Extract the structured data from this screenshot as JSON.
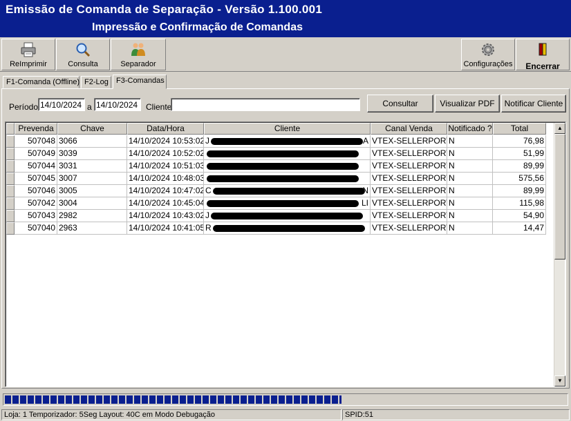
{
  "window": {
    "title": "Emissão de Comanda de Separação - Versão 1.100.001",
    "subtitle": "Impressão e Confirmação de Comandas"
  },
  "toolbar": {
    "reimprimir": {
      "label": "ReImprimir",
      "icon": "printer-icon"
    },
    "consulta": {
      "label": "Consulta",
      "icon": "magnifier-icon"
    },
    "separador": {
      "label": "Separador",
      "icon": "people-icon"
    },
    "configuracoes": {
      "label": "Configurações",
      "icon": "gear-icon"
    },
    "encerrar": {
      "label": "Encerrar",
      "icon": "exit-door-icon"
    }
  },
  "tabs": [
    {
      "label": "F1-Comanda (Offline)"
    },
    {
      "label": "F2-Log"
    },
    {
      "label": "F3-Comandas"
    }
  ],
  "filter": {
    "periodo_label": "Período",
    "date_from": "14/10/2024",
    "a_label": "a",
    "date_to": "14/10/2024",
    "cliente_label": "Cliente",
    "cliente_value": "",
    "consultar": "Consultar",
    "visualizar_pdf": "Visualizar PDF",
    "notificar_cliente": "Notificar Cliente"
  },
  "grid": {
    "columns": [
      "Prevenda",
      "Chave",
      "Data/Hora",
      "Cliente",
      "Canal Venda",
      "Notificado ?",
      "Total"
    ],
    "rows": [
      {
        "prevenda": "507048",
        "chave": "3066",
        "datahora": "14/10/2024 10:53:02",
        "cliente_prefix": "J",
        "cliente_suffix": "A",
        "canal": "VTEX-SELLERPORTA",
        "notificado": "N",
        "total": "76,98"
      },
      {
        "prevenda": "507049",
        "chave": "3039",
        "datahora": "14/10/2024 10:52:02",
        "cliente_prefix": "",
        "cliente_suffix": "",
        "canal": "VTEX-SELLERPORTA",
        "notificado": "N",
        "total": "51,99"
      },
      {
        "prevenda": "507044",
        "chave": "3031",
        "datahora": "14/10/2024 10:51:03",
        "cliente_prefix": "",
        "cliente_suffix": "",
        "canal": "VTEX-SELLERPORTA",
        "notificado": "N",
        "total": "89,99"
      },
      {
        "prevenda": "507045",
        "chave": "3007",
        "datahora": "14/10/2024 10:48:03",
        "cliente_prefix": "",
        "cliente_suffix": "",
        "canal": "VTEX-SELLERPORTA",
        "notificado": "N",
        "total": "575,56"
      },
      {
        "prevenda": "507046",
        "chave": "3005",
        "datahora": "14/10/2024 10:47:02",
        "cliente_prefix": "C",
        "cliente_suffix": "N",
        "canal": "VTEX-SELLERPORTA",
        "notificado": "N",
        "total": "89,99"
      },
      {
        "prevenda": "507042",
        "chave": "3004",
        "datahora": "14/10/2024 10:45:04",
        "cliente_prefix": "",
        "cliente_suffix": "LI",
        "canal": "VTEX-SELLERPORTA",
        "notificado": "N",
        "total": "115,98"
      },
      {
        "prevenda": "507043",
        "chave": "2982",
        "datahora": "14/10/2024 10:43:02",
        "cliente_prefix": "J",
        "cliente_suffix": "",
        "canal": "VTEX-SELLERPORTA",
        "notificado": "N",
        "total": "54,90"
      },
      {
        "prevenda": "507040",
        "chave": "2963",
        "datahora": "14/10/2024 10:41:05",
        "cliente_prefix": "R",
        "cliente_suffix": "",
        "canal": "VTEX-SELLERPORTA",
        "notificado": "N",
        "total": "14,47"
      }
    ]
  },
  "progress": {
    "fraction": 0.6
  },
  "status": {
    "left": "Loja: 1 Temporizador: 5Seg Layout: 40C em Modo Debugação",
    "right": "SPID:51"
  },
  "colors": {
    "title_bg": "#0a1f8f",
    "progress": "#0a1f8f",
    "face": "#d4d0c8"
  }
}
